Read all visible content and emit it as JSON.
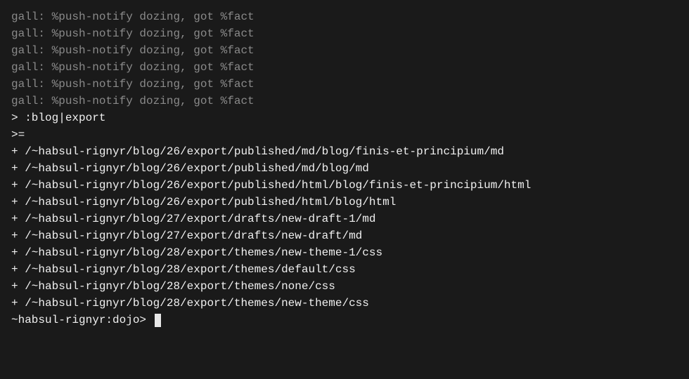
{
  "log_lines": [
    "gall: %push-notify dozing, got %fact",
    "gall: %push-notify dozing, got %fact",
    "gall: %push-notify dozing, got %fact",
    "gall: %push-notify dozing, got %fact",
    "gall: %push-notify dozing, got %fact",
    "gall: %push-notify dozing, got %fact"
  ],
  "command_line": "> :blog|export",
  "result_marker": ">=",
  "export_lines": [
    "+ /~habsul-rignyr/blog/26/export/published/md/blog/finis-et-principium/md",
    "+ /~habsul-rignyr/blog/26/export/published/md/blog/md",
    "+ /~habsul-rignyr/blog/26/export/published/html/blog/finis-et-principium/html",
    "+ /~habsul-rignyr/blog/26/export/published/html/blog/html",
    "+ /~habsul-rignyr/blog/27/export/drafts/new-draft-1/md",
    "+ /~habsul-rignyr/blog/27/export/drafts/new-draft/md",
    "+ /~habsul-rignyr/blog/28/export/themes/new-theme-1/css",
    "+ /~habsul-rignyr/blog/28/export/themes/default/css",
    "+ /~habsul-rignyr/blog/28/export/themes/none/css",
    "+ /~habsul-rignyr/blog/28/export/themes/new-theme/css"
  ],
  "prompt": "~habsul-rignyr:dojo> "
}
